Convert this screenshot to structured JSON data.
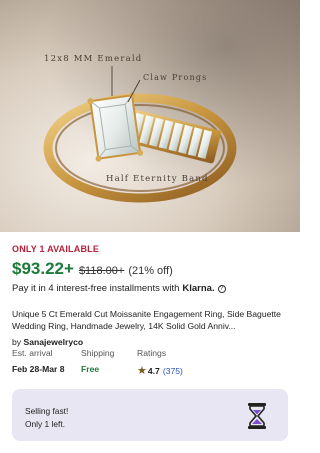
{
  "image_labels": {
    "emerald": "12x8 MM Emerald",
    "prongs": "Claw Prongs",
    "band": "Half Eternity Band"
  },
  "product": {
    "availability": "ONLY 1 AVAILABLE",
    "price": "$93.22+",
    "old_price": "$118.00+",
    "discount": "(21% off)",
    "klarna_text": "Pay it in 4 interest-free installments with",
    "klarna_brand": "Klarna.",
    "title": "Unique 5 Ct Emerald Cut Moissanite Engagement Ring, Side Baguette Wedding Ring, Handmade Jewelry, 14K Solid Gold Anniv...",
    "seller_prefix": "by",
    "seller": "Sanajewelryco"
  },
  "stats": {
    "arrival_label": "Est. arrival",
    "arrival_value": "Feb 28-Mar 8",
    "shipping_label": "Shipping",
    "shipping_value": "Free",
    "ratings_label": "Ratings",
    "rating": "4.7",
    "rating_count": "(375)"
  },
  "callout": {
    "title": "Selling fast!",
    "subtitle": "Only 1 left.",
    "icon": "hourglass-icon"
  },
  "colors": {
    "availability": "#b5213b",
    "price": "#1c7a3a",
    "callout_bg": "#e9e6f3",
    "link": "#2a4fb0"
  }
}
